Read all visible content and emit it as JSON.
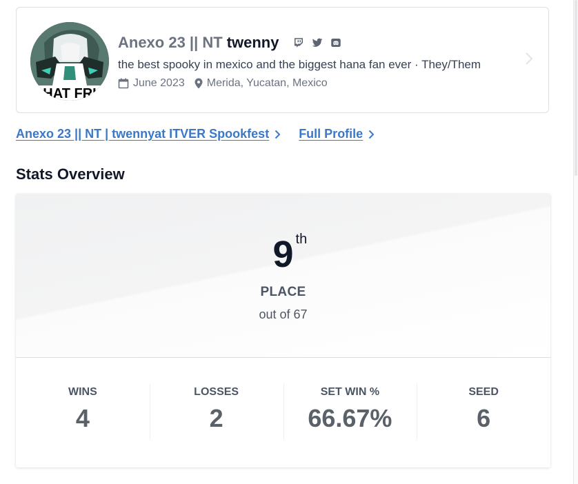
{
  "player": {
    "name_prefix": "Anexo 23 || NT",
    "gamer_tag": "twenny",
    "bio": "the best spooky in mexico and the biggest hana fan ever · They/Them",
    "joined": "June 2023",
    "location": "Merida, Yucatan, Mexico",
    "social_icons": [
      "twitch-icon",
      "twitter-icon",
      "discord-icon"
    ]
  },
  "links": {
    "event_link_name": "Anexo 23 || NT | twenny",
    "event_link_at": " at ITVER Spookfest",
    "profile_link": "Full Profile"
  },
  "stats": {
    "title": "Stats Overview",
    "placement": "9",
    "placement_suffix": "th",
    "place_label": "PLACE",
    "out_of": "out of 67",
    "cells": [
      {
        "label": "WINS",
        "value": "4"
      },
      {
        "label": "LOSSES",
        "value": "2"
      },
      {
        "label": "SET WIN %",
        "value": "66.67%"
      },
      {
        "label": "SEED",
        "value": "6"
      }
    ]
  },
  "colors": {
    "link": "#3b78c8",
    "text_dark": "#111827",
    "text_muted": "#6b7280"
  }
}
